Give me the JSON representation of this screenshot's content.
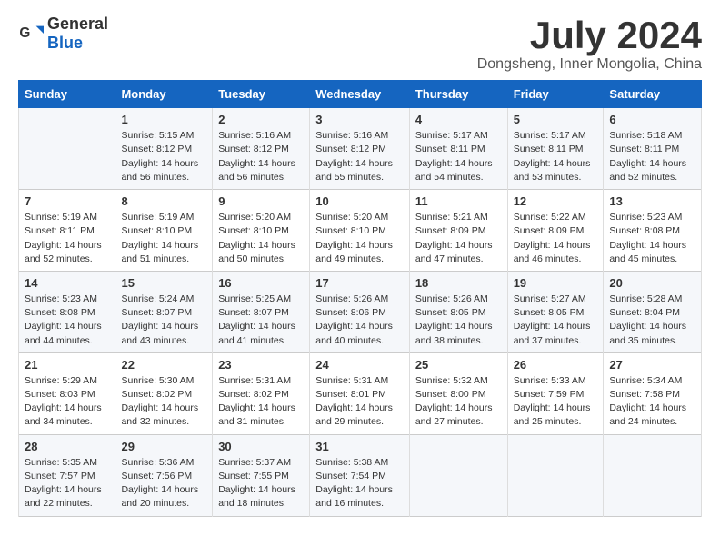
{
  "logo": {
    "general": "General",
    "blue": "Blue"
  },
  "title": "July 2024",
  "subtitle": "Dongsheng, Inner Mongolia, China",
  "days_header": [
    "Sunday",
    "Monday",
    "Tuesday",
    "Wednesday",
    "Thursday",
    "Friday",
    "Saturday"
  ],
  "weeks": [
    [
      {
        "day": "",
        "text": ""
      },
      {
        "day": "1",
        "text": "Sunrise: 5:15 AM\nSunset: 8:12 PM\nDaylight: 14 hours and 56 minutes."
      },
      {
        "day": "2",
        "text": "Sunrise: 5:16 AM\nSunset: 8:12 PM\nDaylight: 14 hours and 56 minutes."
      },
      {
        "day": "3",
        "text": "Sunrise: 5:16 AM\nSunset: 8:12 PM\nDaylight: 14 hours and 55 minutes."
      },
      {
        "day": "4",
        "text": "Sunrise: 5:17 AM\nSunset: 8:11 PM\nDaylight: 14 hours and 54 minutes."
      },
      {
        "day": "5",
        "text": "Sunrise: 5:17 AM\nSunset: 8:11 PM\nDaylight: 14 hours and 53 minutes."
      },
      {
        "day": "6",
        "text": "Sunrise: 5:18 AM\nSunset: 8:11 PM\nDaylight: 14 hours and 52 minutes."
      }
    ],
    [
      {
        "day": "7",
        "text": "Sunrise: 5:19 AM\nSunset: 8:11 PM\nDaylight: 14 hours and 52 minutes."
      },
      {
        "day": "8",
        "text": "Sunrise: 5:19 AM\nSunset: 8:10 PM\nDaylight: 14 hours and 51 minutes."
      },
      {
        "day": "9",
        "text": "Sunrise: 5:20 AM\nSunset: 8:10 PM\nDaylight: 14 hours and 50 minutes."
      },
      {
        "day": "10",
        "text": "Sunrise: 5:20 AM\nSunset: 8:10 PM\nDaylight: 14 hours and 49 minutes."
      },
      {
        "day": "11",
        "text": "Sunrise: 5:21 AM\nSunset: 8:09 PM\nDaylight: 14 hours and 47 minutes."
      },
      {
        "day": "12",
        "text": "Sunrise: 5:22 AM\nSunset: 8:09 PM\nDaylight: 14 hours and 46 minutes."
      },
      {
        "day": "13",
        "text": "Sunrise: 5:23 AM\nSunset: 8:08 PM\nDaylight: 14 hours and 45 minutes."
      }
    ],
    [
      {
        "day": "14",
        "text": "Sunrise: 5:23 AM\nSunset: 8:08 PM\nDaylight: 14 hours and 44 minutes."
      },
      {
        "day": "15",
        "text": "Sunrise: 5:24 AM\nSunset: 8:07 PM\nDaylight: 14 hours and 43 minutes."
      },
      {
        "day": "16",
        "text": "Sunrise: 5:25 AM\nSunset: 8:07 PM\nDaylight: 14 hours and 41 minutes."
      },
      {
        "day": "17",
        "text": "Sunrise: 5:26 AM\nSunset: 8:06 PM\nDaylight: 14 hours and 40 minutes."
      },
      {
        "day": "18",
        "text": "Sunrise: 5:26 AM\nSunset: 8:05 PM\nDaylight: 14 hours and 38 minutes."
      },
      {
        "day": "19",
        "text": "Sunrise: 5:27 AM\nSunset: 8:05 PM\nDaylight: 14 hours and 37 minutes."
      },
      {
        "day": "20",
        "text": "Sunrise: 5:28 AM\nSunset: 8:04 PM\nDaylight: 14 hours and 35 minutes."
      }
    ],
    [
      {
        "day": "21",
        "text": "Sunrise: 5:29 AM\nSunset: 8:03 PM\nDaylight: 14 hours and 34 minutes."
      },
      {
        "day": "22",
        "text": "Sunrise: 5:30 AM\nSunset: 8:02 PM\nDaylight: 14 hours and 32 minutes."
      },
      {
        "day": "23",
        "text": "Sunrise: 5:31 AM\nSunset: 8:02 PM\nDaylight: 14 hours and 31 minutes."
      },
      {
        "day": "24",
        "text": "Sunrise: 5:31 AM\nSunset: 8:01 PM\nDaylight: 14 hours and 29 minutes."
      },
      {
        "day": "25",
        "text": "Sunrise: 5:32 AM\nSunset: 8:00 PM\nDaylight: 14 hours and 27 minutes."
      },
      {
        "day": "26",
        "text": "Sunrise: 5:33 AM\nSunset: 7:59 PM\nDaylight: 14 hours and 25 minutes."
      },
      {
        "day": "27",
        "text": "Sunrise: 5:34 AM\nSunset: 7:58 PM\nDaylight: 14 hours and 24 minutes."
      }
    ],
    [
      {
        "day": "28",
        "text": "Sunrise: 5:35 AM\nSunset: 7:57 PM\nDaylight: 14 hours and 22 minutes."
      },
      {
        "day": "29",
        "text": "Sunrise: 5:36 AM\nSunset: 7:56 PM\nDaylight: 14 hours and 20 minutes."
      },
      {
        "day": "30",
        "text": "Sunrise: 5:37 AM\nSunset: 7:55 PM\nDaylight: 14 hours and 18 minutes."
      },
      {
        "day": "31",
        "text": "Sunrise: 5:38 AM\nSunset: 7:54 PM\nDaylight: 14 hours and 16 minutes."
      },
      {
        "day": "",
        "text": ""
      },
      {
        "day": "",
        "text": ""
      },
      {
        "day": "",
        "text": ""
      }
    ]
  ]
}
